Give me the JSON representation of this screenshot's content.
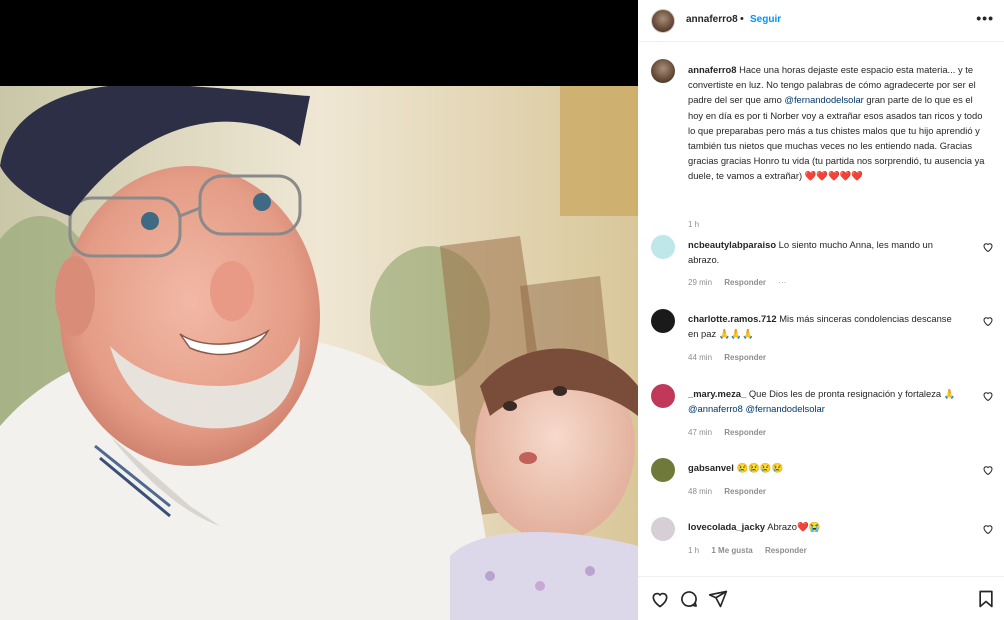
{
  "post": {
    "username": "annaferro8",
    "follow_label": "Seguir",
    "more_icon": "more-options-icon"
  },
  "caption": {
    "username": "annaferro8",
    "text_before_mention": "Hace una horas dejaste este espacio esta materia... y te convertiste en luz. No tengo palabras de cómo agradecerte por ser el padre del ser que amo ",
    "mention": "@fernandodelsolar",
    "text_after_mention": " gran parte de lo que es el hoy en día es por ti Norber voy a extrañar esos asados tan ricos y todo lo que preparabas pero más a tus chistes malos que tu hijo aprendió y también tus nietos que muchas veces no les entiendo nada. Gracias gracias gracias Honro tu vida (tu partida nos sorprendió, tu ausencia ya duele, te vamos a extrañar) ❤️❤️❤️❤️❤️",
    "time": "1 h"
  },
  "comments": [
    {
      "username": "ncbeautylabparaiso",
      "text": "Lo siento mucho Anna, les mando un abrazo.",
      "time": "29 min",
      "reply_label": "Responder",
      "more": "···",
      "avatar_color": "#bfe6e8"
    },
    {
      "username": "charlotte.ramos.712",
      "text": "Mis más sinceras condolencias descanse en paz 🙏🙏🙏",
      "time": "44 min",
      "reply_label": "Responder",
      "avatar_color": "#1a1a1a"
    },
    {
      "username": "_mary.meza_",
      "text": "Que Dios les de pronta resignación y fortaleza 🙏",
      "mention1": "@annaferro8",
      "mention2": "@fernandodelsolar",
      "time": "47 min",
      "reply_label": "Responder",
      "avatar_color": "#c0395a"
    },
    {
      "username": "gabsanvel",
      "text": "😢😢😢😢",
      "time": "48 min",
      "reply_label": "Responder",
      "avatar_color": "#6f7a3a"
    },
    {
      "username": "lovecolada_jacky",
      "text": "Abrazo❤️😭",
      "time": "1 h",
      "likes": "1 Me gusta",
      "reply_label": "Responder",
      "avatar_color": "#d8cfd6"
    }
  ],
  "actions": {
    "like_icon": "heart-icon",
    "comment_icon": "comment-icon",
    "share_icon": "share-icon",
    "save_icon": "bookmark-icon"
  }
}
